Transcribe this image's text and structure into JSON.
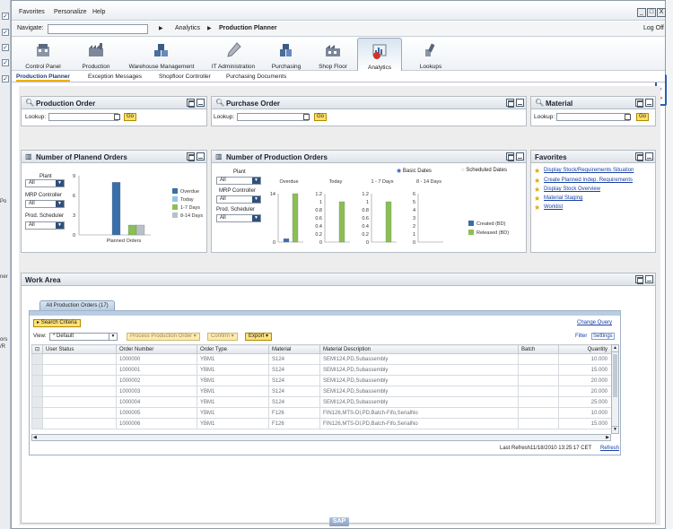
{
  "left_strip": {
    "items": [
      "✓",
      "✓",
      "✓",
      "✓",
      "✓"
    ],
    "fragments": [
      "Po",
      "ner",
      "ors",
      "/R"
    ]
  },
  "menu": {
    "items": [
      "Favorites",
      "Personalize",
      "Help"
    ]
  },
  "window_buttons": [
    "_",
    "□",
    "X"
  ],
  "nav": {
    "label": "Navigate:",
    "input_value": "",
    "crumbs": [
      "Analytics",
      "Production Planner"
    ],
    "logoff": "Log Off"
  },
  "tabs": [
    {
      "label": "Control Panel",
      "icon": "control-panel-icon"
    },
    {
      "label": "Production",
      "icon": "factory-icon"
    },
    {
      "label": "Warehouse Management",
      "icon": "warehouse-icon"
    },
    {
      "label": "IT Administration",
      "icon": "pen-icon"
    },
    {
      "label": "Purchasing",
      "icon": "purchasing-icon"
    },
    {
      "label": "Shop Floor",
      "icon": "shopfloor-icon"
    },
    {
      "label": "Analytics",
      "icon": "analytics-icon"
    },
    {
      "label": "Lookups",
      "icon": "lookups-icon"
    }
  ],
  "subtabs": [
    "Production Planner",
    "Exception Messages",
    "Shopfloor Controller",
    "Purchasing Documents"
  ],
  "panels": {
    "production_order": {
      "title": "Production Order",
      "lookup_label": "Lookup:",
      "go": "Go"
    },
    "purchase_order": {
      "title": "Purchase Order",
      "lookup_label": "Lookup:",
      "go": "Go"
    },
    "material": {
      "title": "Material",
      "lookup_label": "Lookup:",
      "go": "Go"
    },
    "planned_orders": {
      "title": "Number of Planend Orders",
      "plant_label": "Plant",
      "plant_value": "All",
      "mrp_label": "MRP Controller",
      "mrp_value": "All",
      "sched_label": "Prod. Scheduler",
      "sched_value": "All"
    },
    "production_orders": {
      "title": "Number of Production Orders",
      "plant_label": "Plant",
      "plant_value": "All",
      "mrp_label": "MRP Controller",
      "mrp_value": "All",
      "sched_label": "Prod. Scheduler",
      "sched_value": "All",
      "basic_dates": "Basic Dates",
      "scheduled_dates": "Scheduled Dates"
    },
    "favorites": {
      "title": "Favorites",
      "links": [
        "Display Stock/Requirements Situation",
        "Create Planned Indep. Requirements",
        "Display Stock Overview",
        "Material Staging",
        "Worklist"
      ]
    }
  },
  "chart_data": [
    {
      "type": "bar",
      "title": "Number of Planend Orders",
      "categories": [
        "Planned Orders"
      ],
      "series": [
        {
          "name": "Overdue",
          "values": [
            8
          ]
        },
        {
          "name": "Today",
          "values": [
            0
          ]
        },
        {
          "name": "1-7 Days",
          "values": [
            1.5
          ]
        },
        {
          "name": "8-14 Days",
          "values": [
            1.5
          ]
        }
      ],
      "yticks": [
        "9",
        "6",
        "3",
        "0"
      ],
      "ylim": [
        0,
        9
      ],
      "legend": "right",
      "colors": {
        "Overdue": "#3a6ea8",
        "Today": "#8fc6e8",
        "1-7 Days": "#8cbf52",
        "8-14 Days": "#b9c0c6"
      }
    },
    {
      "type": "bar",
      "title": "Number of Production Orders",
      "subcharts": [
        {
          "label": "Overdue",
          "yticks": [
            "14",
            "",
            "0"
          ],
          "ylim": [
            0,
            14
          ],
          "series": [
            {
              "name": "Created (BD)",
              "value": 1
            },
            {
              "name": "Released (BD)",
              "value": 14
            }
          ]
        },
        {
          "label": "Today",
          "yticks": [
            "1.2",
            "1",
            "0.8",
            "0.6",
            "0.4",
            "0.2",
            "0"
          ],
          "ylim": [
            0,
            1.2
          ],
          "series": [
            {
              "name": "Created (BD)",
              "value": 0
            },
            {
              "name": "Released (BD)",
              "value": 1
            }
          ]
        },
        {
          "label": "1 - 7 Days",
          "yticks": [
            "1.2",
            "1",
            "0.8",
            "0.6",
            "0.4",
            "0.2",
            "0"
          ],
          "ylim": [
            0,
            1.2
          ],
          "series": [
            {
              "name": "Created (BD)",
              "value": 0
            },
            {
              "name": "Released (BD)",
              "value": 1
            }
          ]
        },
        {
          "label": "8 - 14 Days",
          "yticks": [
            "6",
            "5",
            "4",
            "3",
            "2",
            "1",
            "0"
          ],
          "ylim": [
            0,
            6
          ],
          "series": [
            {
              "name": "Created (BD)",
              "value": 0
            },
            {
              "name": "Released (BD)",
              "value": 0
            }
          ]
        }
      ],
      "legend": [
        "Created (BD)",
        "Released (BD)"
      ],
      "colors": {
        "Created (BD)": "#3a6ea8",
        "Released (BD)": "#8cbf52"
      }
    }
  ],
  "work_area": {
    "title": "Work Area",
    "tab": "All Production Orders (17)",
    "search_criteria": "Search Criteria",
    "change_query": "Change Query",
    "view_label": "View:",
    "view_value": "* Default",
    "buttons": [
      "Process Production Order",
      "Confirm",
      "Export"
    ],
    "filter": "Filter",
    "settings": "Settings",
    "columns": [
      "User Status",
      "Order Number",
      "Order Type",
      "Material",
      "Material Description",
      "Batch",
      "Quantity"
    ],
    "rows": [
      [
        "",
        "1000000",
        "YBM1",
        "S124",
        "SEMI124,PD,Subassembly",
        "",
        "10.000"
      ],
      [
        "",
        "1000001",
        "YBM1",
        "S124",
        "SEMI124,PD,Subassembly",
        "",
        "15.000"
      ],
      [
        "",
        "1000002",
        "YBM1",
        "S124",
        "SEMI124,PD,Subassembly",
        "",
        "20.000"
      ],
      [
        "",
        "1000003",
        "YBM1",
        "S124",
        "SEMI124,PD,Subassembly",
        "",
        "20.000"
      ],
      [
        "",
        "1000004",
        "YBM1",
        "S124",
        "SEMI124,PD,Subassembly",
        "",
        "25.000"
      ],
      [
        "",
        "1000005",
        "YBM1",
        "F126",
        "FIN126,MTS-DI,PD,Batch-Fifo,SerialNo",
        "",
        "10.000"
      ],
      [
        "",
        "1000006",
        "YBM1",
        "F126",
        "FIN126,MTS-DI,PD,Batch-Fifo,SerialNo",
        "",
        "15.000"
      ]
    ],
    "last_refresh_label": "Last Refresh",
    "last_refresh_value": "11/18/2010 13:25:17 CET",
    "refresh": "Refresh"
  },
  "footer": {
    "logo": "SAP"
  }
}
